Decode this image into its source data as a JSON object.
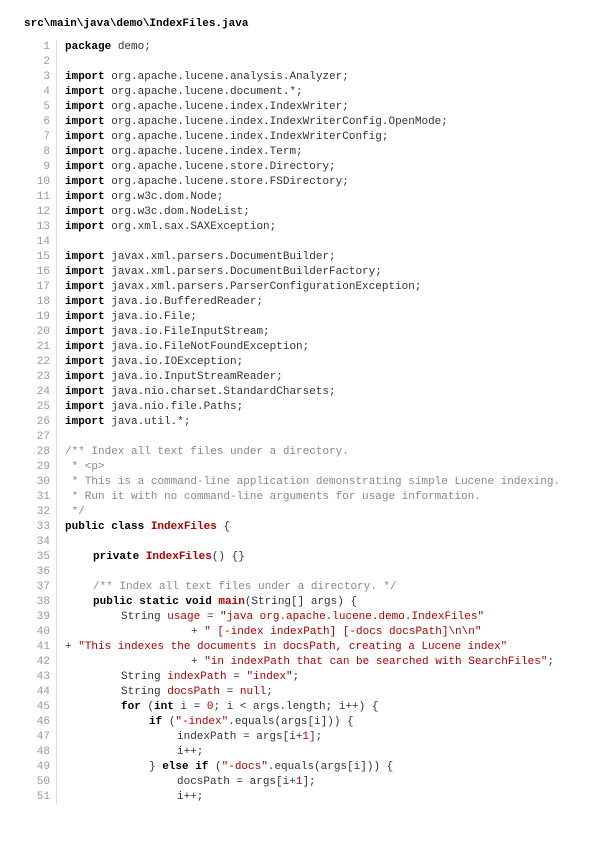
{
  "file": {
    "path": "src\\main\\java\\demo\\IndexFiles.java"
  },
  "code": {
    "lines": [
      {
        "n": 1,
        "segs": [
          {
            "t": "package ",
            "c": "kw"
          },
          {
            "t": "demo;",
            "c": "plain"
          }
        ]
      },
      {
        "n": 2,
        "segs": [
          {
            "t": " ",
            "c": "plain"
          }
        ]
      },
      {
        "n": 3,
        "segs": [
          {
            "t": "import ",
            "c": "kw"
          },
          {
            "t": "org.apache.lucene.analysis.Analyzer;",
            "c": "plain"
          }
        ]
      },
      {
        "n": 4,
        "segs": [
          {
            "t": "import ",
            "c": "kw"
          },
          {
            "t": "org.apache.lucene.document.*;",
            "c": "plain"
          }
        ]
      },
      {
        "n": 5,
        "segs": [
          {
            "t": "import ",
            "c": "kw"
          },
          {
            "t": "org.apache.lucene.index.IndexWriter;",
            "c": "plain"
          }
        ]
      },
      {
        "n": 6,
        "segs": [
          {
            "t": "import ",
            "c": "kw"
          },
          {
            "t": "org.apache.lucene.index.IndexWriterConfig.OpenMode;",
            "c": "plain"
          }
        ]
      },
      {
        "n": 7,
        "segs": [
          {
            "t": "import ",
            "c": "kw"
          },
          {
            "t": "org.apache.lucene.index.IndexWriterConfig;",
            "c": "plain"
          }
        ]
      },
      {
        "n": 8,
        "segs": [
          {
            "t": "import ",
            "c": "kw"
          },
          {
            "t": "org.apache.lucene.index.Term;",
            "c": "plain"
          }
        ]
      },
      {
        "n": 9,
        "segs": [
          {
            "t": "import ",
            "c": "kw"
          },
          {
            "t": "org.apache.lucene.store.Directory;",
            "c": "plain"
          }
        ]
      },
      {
        "n": 10,
        "segs": [
          {
            "t": "import ",
            "c": "kw"
          },
          {
            "t": "org.apache.lucene.store.FSDirectory;",
            "c": "plain"
          }
        ]
      },
      {
        "n": 11,
        "segs": [
          {
            "t": "import ",
            "c": "kw"
          },
          {
            "t": "org.w3c.dom.Node;",
            "c": "plain"
          }
        ]
      },
      {
        "n": 12,
        "segs": [
          {
            "t": "import ",
            "c": "kw"
          },
          {
            "t": "org.w3c.dom.NodeList;",
            "c": "plain"
          }
        ]
      },
      {
        "n": 13,
        "segs": [
          {
            "t": "import ",
            "c": "kw"
          },
          {
            "t": "org.xml.sax.SAXException;",
            "c": "plain"
          }
        ]
      },
      {
        "n": 14,
        "segs": [
          {
            "t": " ",
            "c": "plain"
          }
        ]
      },
      {
        "n": 15,
        "segs": [
          {
            "t": "import ",
            "c": "kw"
          },
          {
            "t": "javax.xml.parsers.DocumentBuilder;",
            "c": "plain"
          }
        ]
      },
      {
        "n": 16,
        "segs": [
          {
            "t": "import ",
            "c": "kw"
          },
          {
            "t": "javax.xml.parsers.DocumentBuilderFactory;",
            "c": "plain"
          }
        ]
      },
      {
        "n": 17,
        "segs": [
          {
            "t": "import ",
            "c": "kw"
          },
          {
            "t": "javax.xml.parsers.ParserConfigurationException;",
            "c": "plain"
          }
        ]
      },
      {
        "n": 18,
        "segs": [
          {
            "t": "import ",
            "c": "kw"
          },
          {
            "t": "java.io.BufferedReader;",
            "c": "plain"
          }
        ]
      },
      {
        "n": 19,
        "segs": [
          {
            "t": "import ",
            "c": "kw"
          },
          {
            "t": "java.io.File;",
            "c": "plain"
          }
        ]
      },
      {
        "n": 20,
        "segs": [
          {
            "t": "import ",
            "c": "kw"
          },
          {
            "t": "java.io.FileInputStream;",
            "c": "plain"
          }
        ]
      },
      {
        "n": 21,
        "segs": [
          {
            "t": "import ",
            "c": "kw"
          },
          {
            "t": "java.io.FileNotFoundException;",
            "c": "plain"
          }
        ]
      },
      {
        "n": 22,
        "segs": [
          {
            "t": "import ",
            "c": "kw"
          },
          {
            "t": "java.io.IOException;",
            "c": "plain"
          }
        ]
      },
      {
        "n": 23,
        "segs": [
          {
            "t": "import ",
            "c": "kw"
          },
          {
            "t": "java.io.InputStreamReader;",
            "c": "plain"
          }
        ]
      },
      {
        "n": 24,
        "segs": [
          {
            "t": "import ",
            "c": "kw"
          },
          {
            "t": "java.nio.charset.StandardCharsets;",
            "c": "plain"
          }
        ]
      },
      {
        "n": 25,
        "segs": [
          {
            "t": "import ",
            "c": "kw"
          },
          {
            "t": "java.nio.file.Paths;",
            "c": "plain"
          }
        ]
      },
      {
        "n": 26,
        "segs": [
          {
            "t": "import ",
            "c": "kw"
          },
          {
            "t": "java.util.*;",
            "c": "plain"
          }
        ]
      },
      {
        "n": 27,
        "segs": [
          {
            "t": " ",
            "c": "plain"
          }
        ]
      },
      {
        "n": 28,
        "segs": [
          {
            "t": "/** Index all text files under a directory.",
            "c": "cmt"
          }
        ]
      },
      {
        "n": 29,
        "segs": [
          {
            "t": " * <p>",
            "c": "cmt"
          }
        ]
      },
      {
        "n": 30,
        "segs": [
          {
            "t": " * This is a command-line application demonstrating simple Lucene indexing.",
            "c": "cmt"
          }
        ]
      },
      {
        "n": 31,
        "segs": [
          {
            "t": " * Run it with no command-line arguments for usage information.",
            "c": "cmt"
          }
        ]
      },
      {
        "n": 32,
        "segs": [
          {
            "t": " */",
            "c": "cmt"
          }
        ]
      },
      {
        "n": 33,
        "segs": [
          {
            "t": "public class ",
            "c": "kw"
          },
          {
            "t": "IndexFiles",
            "c": "cls"
          },
          {
            "t": " {",
            "c": "plain"
          }
        ]
      },
      {
        "n": 34,
        "segs": [
          {
            "t": " ",
            "c": "plain"
          }
        ]
      },
      {
        "n": 35,
        "indent": 1,
        "segs": [
          {
            "t": "private ",
            "c": "kw"
          },
          {
            "t": "IndexFiles",
            "c": "method"
          },
          {
            "t": "() {}",
            "c": "plain"
          }
        ]
      },
      {
        "n": 36,
        "segs": [
          {
            "t": " ",
            "c": "plain"
          }
        ]
      },
      {
        "n": 37,
        "indent": 1,
        "segs": [
          {
            "t": "/** Index all text files under a directory. */",
            "c": "cmt"
          }
        ]
      },
      {
        "n": 38,
        "indent": 1,
        "segs": [
          {
            "t": "public static void ",
            "c": "kw"
          },
          {
            "t": "main",
            "c": "method"
          },
          {
            "t": "(String[] args) {",
            "c": "plain"
          }
        ]
      },
      {
        "n": 39,
        "indent": 2,
        "segs": [
          {
            "t": "String ",
            "c": "plain"
          },
          {
            "t": "usage",
            "c": "var"
          },
          {
            "t": " = ",
            "c": "plain"
          },
          {
            "t": "\"java org.apache.lucene.demo.IndexFiles\"",
            "c": "str"
          }
        ]
      },
      {
        "n": 40,
        "cont": true,
        "segs": [
          {
            "t": "+ ",
            "c": "plain"
          },
          {
            "t": "\" [-index indexPath] [-docs docsPath]\\n\\n\"",
            "c": "str"
          }
        ]
      },
      {
        "n": 41,
        "cont": true,
        "wrap": true,
        "segs": [
          {
            "t": "+ ",
            "c": "plain"
          },
          {
            "t": "\"This indexes the documents in docsPath, creating a Lucene index\"",
            "c": "str"
          }
        ]
      },
      {
        "n": 42,
        "cont": true,
        "segs": [
          {
            "t": "+ ",
            "c": "plain"
          },
          {
            "t": "\"in indexPath that can be searched with SearchFiles\"",
            "c": "str"
          },
          {
            "t": ";",
            "c": "plain"
          }
        ]
      },
      {
        "n": 43,
        "indent": 2,
        "segs": [
          {
            "t": "String ",
            "c": "plain"
          },
          {
            "t": "indexPath",
            "c": "var"
          },
          {
            "t": " = ",
            "c": "plain"
          },
          {
            "t": "\"index\"",
            "c": "str"
          },
          {
            "t": ";",
            "c": "plain"
          }
        ]
      },
      {
        "n": 44,
        "indent": 2,
        "segs": [
          {
            "t": "String ",
            "c": "plain"
          },
          {
            "t": "docsPath",
            "c": "var"
          },
          {
            "t": " = ",
            "c": "plain"
          },
          {
            "t": "null",
            "c": "null"
          },
          {
            "t": ";",
            "c": "plain"
          }
        ]
      },
      {
        "n": 45,
        "indent": 2,
        "segs": [
          {
            "t": "for ",
            "c": "kw"
          },
          {
            "t": "(",
            "c": "plain"
          },
          {
            "t": "int ",
            "c": "kw"
          },
          {
            "t": "i = ",
            "c": "plain"
          },
          {
            "t": "0",
            "c": "str"
          },
          {
            "t": "; i < args.length; i++) {",
            "c": "plain"
          }
        ]
      },
      {
        "n": 46,
        "indent": 3,
        "segs": [
          {
            "t": "if ",
            "c": "kw"
          },
          {
            "t": "(",
            "c": "plain"
          },
          {
            "t": "\"-index\"",
            "c": "str"
          },
          {
            "t": ".equals(args[i])) {",
            "c": "plain"
          }
        ]
      },
      {
        "n": 47,
        "indent": 4,
        "segs": [
          {
            "t": "indexPath = args[i+",
            "c": "plain"
          },
          {
            "t": "1",
            "c": "str"
          },
          {
            "t": "];",
            "c": "plain"
          }
        ]
      },
      {
        "n": 48,
        "indent": 4,
        "segs": [
          {
            "t": "i++;",
            "c": "plain"
          }
        ]
      },
      {
        "n": 49,
        "indent": 3,
        "segs": [
          {
            "t": "} ",
            "c": "plain"
          },
          {
            "t": "else if ",
            "c": "kw"
          },
          {
            "t": "(",
            "c": "plain"
          },
          {
            "t": "\"-docs\"",
            "c": "str"
          },
          {
            "t": ".equals(args[i])) {",
            "c": "plain"
          }
        ]
      },
      {
        "n": 50,
        "indent": 4,
        "segs": [
          {
            "t": "docsPath = args[i+",
            "c": "plain"
          },
          {
            "t": "1",
            "c": "str"
          },
          {
            "t": "];",
            "c": "plain"
          }
        ]
      },
      {
        "n": 51,
        "indent": 4,
        "segs": [
          {
            "t": "i++;",
            "c": "plain"
          }
        ]
      }
    ]
  }
}
